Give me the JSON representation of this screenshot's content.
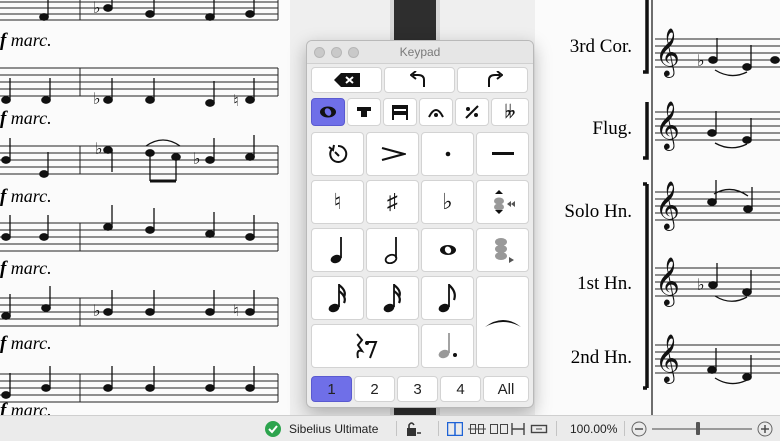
{
  "score": {
    "marking": "marc.",
    "dynamic": "f",
    "instruments": [
      "3rd Cor.",
      "Flug.",
      "Solo Hn.",
      "1st Hn.",
      "2nd Hn."
    ]
  },
  "keypad": {
    "title": "Keypad",
    "layout_tabs": [
      "1",
      "2",
      "3",
      "4",
      "All"
    ],
    "selected_tab": "1"
  },
  "status": {
    "app_name": "Sibelius Ultimate",
    "zoom": "100.00%"
  },
  "colors": {
    "accent": "#6f6fe8",
    "ok": "#2da44e"
  }
}
